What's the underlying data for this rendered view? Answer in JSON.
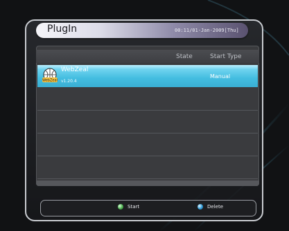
{
  "header": {
    "title": "PlugIn",
    "clock": "00:11/01-Jan-2009[Thu]"
  },
  "table": {
    "columns": {
      "state": "State",
      "start_type": "Start Type"
    },
    "rows": [
      {
        "name": "WebZeal",
        "version": "v1.20.4",
        "state": "",
        "start_type": "Manual",
        "icon_label": "WebZeal",
        "selected": true
      }
    ]
  },
  "footer": {
    "start_label": "Start",
    "start_color": "#4caf50",
    "delete_label": "Delete",
    "delete_color": "#2f9bd8"
  },
  "colors": {
    "accent": "#43bde0",
    "background": "#111214"
  },
  "icons": {
    "plugin": "webzeal-globe-icon",
    "start": "green-dot-icon",
    "delete": "blue-dot-icon"
  }
}
